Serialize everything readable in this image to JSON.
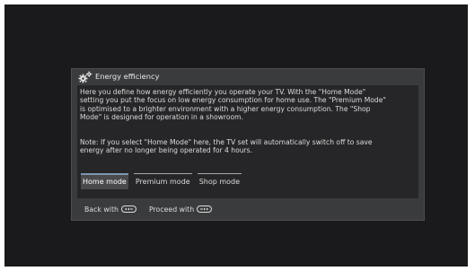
{
  "dialog": {
    "title": "Energy efficiency",
    "icon": "gear-icon",
    "description": "Here you define how energy efficiently you operate your TV. With the  \"Home Mode\"\nsetting you put the focus on low energy consumption for home use. The \"Premium Mode\"\nis optimised to a brighter environment with a higher energy consumption. The \"Shop\nMode\" is designed for operation in a showroom.",
    "note": "Note: If you select  \"Home Mode\" here, the TV set will automatically switch off to save\nenergy after no longer being operated for 4 hours.",
    "modes": [
      {
        "label": "Home mode",
        "selected": true
      },
      {
        "label": "Premium mode",
        "selected": false
      },
      {
        "label": "Shop mode",
        "selected": false
      }
    ],
    "footer": {
      "back_label": "Back with",
      "back_icon": "remote-back-button-icon",
      "proceed_label": "Proceed with",
      "proceed_icon": "remote-ok-button-icon"
    }
  },
  "colors": {
    "screen_background": "#1a1a1c",
    "dialog_background": "#3a3b3c",
    "panel_background": "#262628",
    "selection_accent": "#7e97b0"
  }
}
